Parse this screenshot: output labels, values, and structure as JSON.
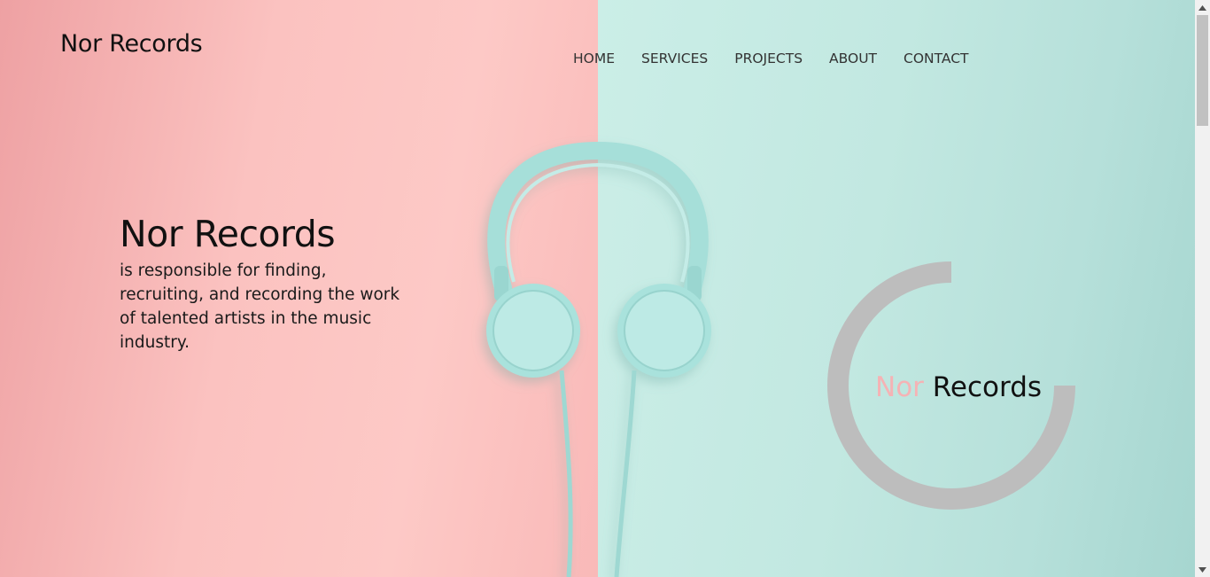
{
  "brand": {
    "logo_text": "Nor Records"
  },
  "nav": {
    "items": [
      "HOME",
      "SERVICES",
      "PROJECTS",
      "ABOUT",
      "CONTACT"
    ]
  },
  "hero": {
    "title": "Nor Records",
    "description": "is responsible for finding, recruiting, and recording the work of talented artists in the music industry."
  },
  "badge": {
    "accent_word": "Nor",
    "word": "Records"
  },
  "colors": {
    "pink_bg": "#fbc2c0",
    "mint_bg": "#c2e8e1",
    "accent_pink": "#f5b3b5",
    "ring_gray": "#bdbdbd",
    "headphone_mint": "#a8e1db"
  },
  "icons": {
    "hero_image": "headphones-icon",
    "scroll_up": "arrow-up-icon",
    "scroll_down": "arrow-down-icon"
  }
}
